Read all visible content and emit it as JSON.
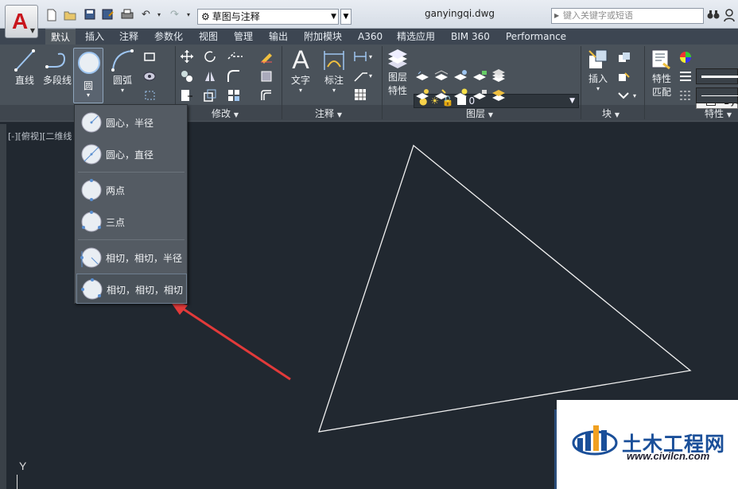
{
  "titlebar": {
    "workspace": "草图与注释",
    "document_title": "ganyingqi.dwg",
    "search_placeholder": "键入关键字或短语"
  },
  "tabs": [
    "默认",
    "插入",
    "注释",
    "参数化",
    "视图",
    "管理",
    "输出",
    "附加模块",
    "A360",
    "精选应用",
    "BIM 360",
    "Performance"
  ],
  "active_tab": "默认",
  "ribbon": {
    "draw": {
      "line_label": "直线",
      "polyline_label": "多段线",
      "circle_label": "圆",
      "arc_label": "圆弧"
    },
    "modify": {
      "title": "修改"
    },
    "annotation": {
      "text_label": "文字",
      "dimension_label": "标注",
      "title": "注释"
    },
    "layers": {
      "properties_label_1": "图层",
      "properties_label_2": "特性",
      "current_layer": "0",
      "title": "图层"
    },
    "block": {
      "insert_label": "插入",
      "title": "块"
    },
    "properties": {
      "match_label_1": "特性",
      "match_label_2": "匹配",
      "color_value": "Byl",
      "title": "特性"
    }
  },
  "circle_menu": {
    "items": [
      "圆心，半径",
      "圆心，直径",
      "两点",
      "三点",
      "相切，相切，半径",
      "相切，相切，相切"
    ]
  },
  "viewport": {
    "label": "[-][俯视][二维线",
    "ucs_y": "Y"
  },
  "watermark": {
    "name": "土木工程网",
    "url": "www.civilcn.com"
  },
  "colors": {
    "drawing_bg": "#212830",
    "ribbon_bg": "#4a525a",
    "arrow": "#e23a3a",
    "logo_red": "#c8161d"
  }
}
